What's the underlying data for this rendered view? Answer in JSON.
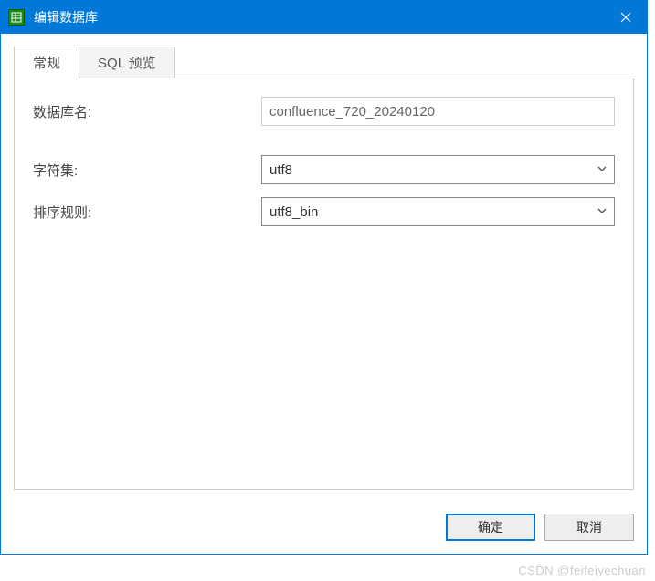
{
  "titlebar": {
    "title": "编辑数据库"
  },
  "tabs": [
    {
      "label": "常规",
      "active": true
    },
    {
      "label": "SQL 预览",
      "active": false
    }
  ],
  "form": {
    "db_name_label": "数据库名:",
    "db_name_value": "confluence_720_20240120",
    "charset_label": "字符集:",
    "charset_value": "utf8",
    "collation_label": "排序规则:",
    "collation_value": "utf8_bin"
  },
  "buttons": {
    "ok": "确定",
    "cancel": "取消"
  },
  "watermark": "CSDN @feifeiyechuan"
}
